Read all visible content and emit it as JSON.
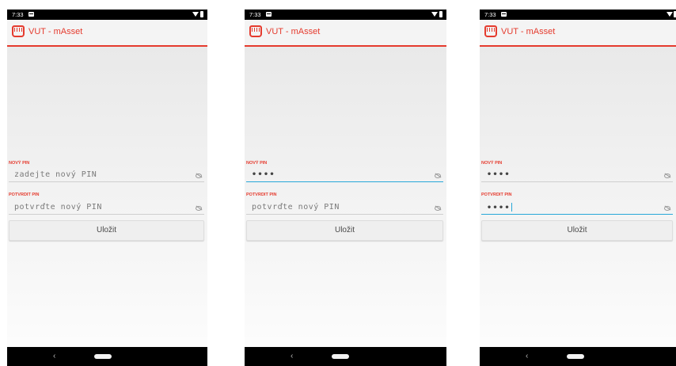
{
  "screens": [
    {
      "status_time": "7:33",
      "app_title": "VUT - mAsset",
      "new_pin": {
        "label": "NOVÝ PIN",
        "value": "",
        "placeholder": "zadejte nový PIN"
      },
      "confirm_pin": {
        "label": "POTVRDIT PIN",
        "value": "",
        "placeholder": "potvrďte nový PIN"
      },
      "save_label": "Uložit",
      "back_glyph": "‹"
    },
    {
      "status_time": "7:33",
      "app_title": "VUT - mAsset",
      "new_pin": {
        "label": "NOVÝ PIN",
        "value": "••••",
        "placeholder": ""
      },
      "confirm_pin": {
        "label": "POTVRDIT PIN",
        "value": "",
        "placeholder": "potvrďte nový PIN"
      },
      "save_label": "Uložit",
      "back_glyph": "‹"
    },
    {
      "status_time": "7:33",
      "app_title": "VUT - mAsset",
      "new_pin": {
        "label": "NOVÝ PIN",
        "value": "••••",
        "placeholder": ""
      },
      "confirm_pin": {
        "label": "POTVRDIT PIN",
        "value": "••••",
        "placeholder": ""
      },
      "save_label": "Uložit",
      "back_glyph": "‹"
    }
  ],
  "colors": {
    "accent": "#e53b2e",
    "focus": "#27a8d8"
  },
  "icons": [
    "notification-icon",
    "wifi-icon",
    "battery-icon",
    "app-logo-icon",
    "visibility-toggle-icon",
    "back-icon",
    "home-pill-icon"
  ]
}
